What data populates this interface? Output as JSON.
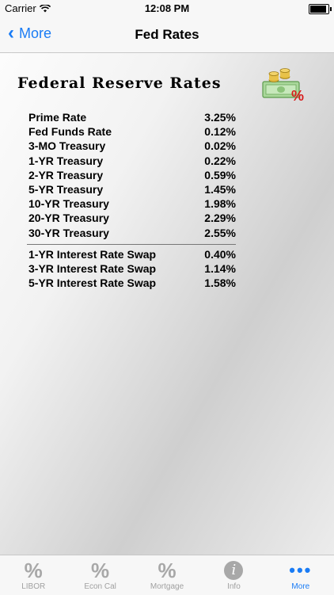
{
  "status_bar": {
    "carrier": "Carrier",
    "time": "12:08 PM"
  },
  "nav": {
    "back_label": "More",
    "title": "Fed Rates"
  },
  "main": {
    "heading": "Federal Reserve Rates",
    "rates": [
      {
        "name": "Prime Rate",
        "value": "3.25%"
      },
      {
        "name": "Fed Funds Rate",
        "value": "0.12%"
      },
      {
        "name": "3-MO Treasury",
        "value": "0.02%"
      },
      {
        "name": "1-YR Treasury",
        "value": "0.22%"
      },
      {
        "name": "2-YR Treasury",
        "value": "0.59%"
      },
      {
        "name": "5-YR Treasury",
        "value": "1.45%"
      },
      {
        "name": "10-YR Treasury",
        "value": "1.98%"
      },
      {
        "name": "20-YR Treasury",
        "value": "2.29%"
      },
      {
        "name": "30-YR Treasury",
        "value": "2.55%"
      }
    ],
    "swaps": [
      {
        "name": "1-YR Interest Rate Swap",
        "value": "0.40%"
      },
      {
        "name": "3-YR Interest Rate Swap",
        "value": "1.14%"
      },
      {
        "name": "5-YR Interest Rate Swap",
        "value": "1.58%"
      }
    ]
  },
  "tabs": [
    {
      "label": "LIBOR",
      "icon": "percent-icon",
      "glyph": "%"
    },
    {
      "label": "Econ Cal",
      "icon": "percent-icon",
      "glyph": "%"
    },
    {
      "label": "Mortgage",
      "icon": "percent-icon",
      "glyph": "%"
    },
    {
      "label": "Info",
      "icon": "info-icon",
      "glyph": "i"
    },
    {
      "label": "More",
      "icon": "more-dots-icon",
      "glyph": "•••"
    }
  ],
  "colors": {
    "accent": "#1a7cf5",
    "tab_inactive": "#a8a8a8"
  }
}
